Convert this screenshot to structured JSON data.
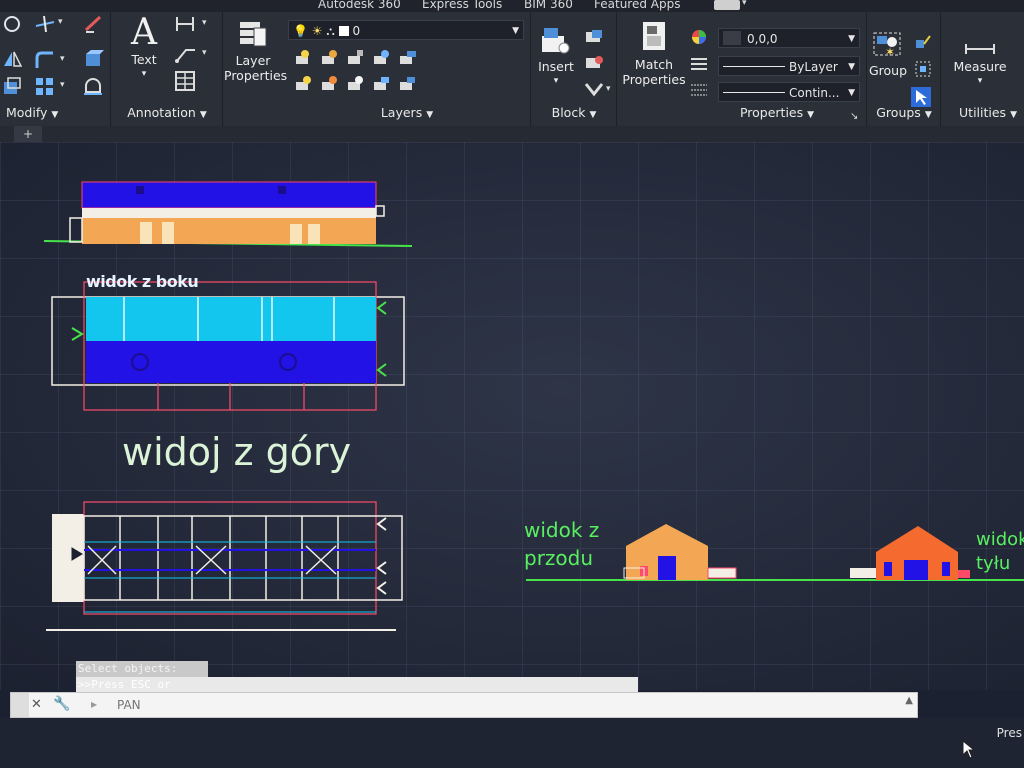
{
  "tabs": [
    "Autodesk 360",
    "Express Tools",
    "BIM 360",
    "Featured Apps"
  ],
  "panels": {
    "modify": "Modify",
    "annotation": "Annotation",
    "layers": "Layers",
    "block": "Block",
    "properties": "Properties",
    "groups": "Groups",
    "utilities": "Utilities"
  },
  "buttons": {
    "text": "Text",
    "layer_properties": "Layer\nProperties",
    "insert": "Insert",
    "match_properties": "Match\nProperties",
    "group": "Group",
    "measure": "Measure"
  },
  "layer_combo": "0",
  "color_combo": "0,0,0",
  "linetype_combo": "ByLayer",
  "lineweight_combo": "Contin...",
  "doc_tab": "+",
  "canvas": {
    "label_top_view": "widoj z góry",
    "label_side_view": "widok z boku",
    "label_front": "widok z\nprzodu",
    "label_back": "widok z\ntyłu"
  },
  "command": {
    "history_1": "Select objects:",
    "history_2": ">>Press ESC or",
    "placeholder": "PAN"
  },
  "status": {
    "text": "Pres"
  },
  "colors": {
    "ribbon": "#2b2f38",
    "canvas": "#242a3a",
    "accent_green": "#48e24a",
    "cad_blue": "#2212e6",
    "cad_cyan": "#13c6ee",
    "cad_orange": "#f59a3c"
  }
}
